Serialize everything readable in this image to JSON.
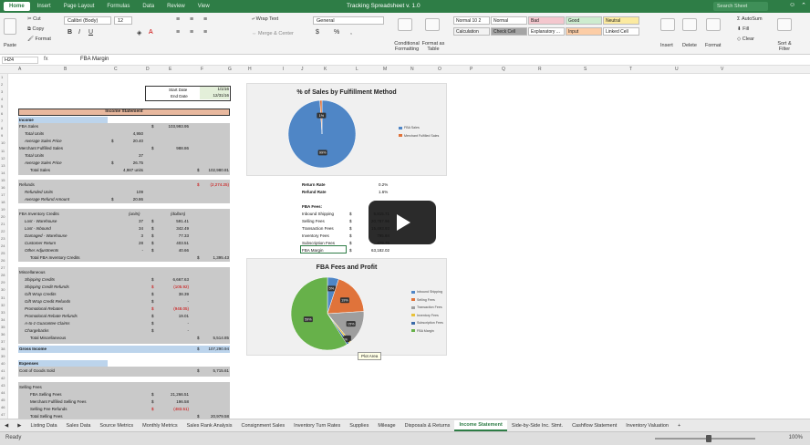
{
  "app": {
    "window_title": "Tracking Spreadsheet v. 1.0",
    "search_placeholder": "Search Sheet",
    "ribbon_tabs": [
      "Home",
      "Insert",
      "Page Layout",
      "Formulas",
      "Data",
      "Review",
      "View"
    ],
    "accent": "#2e7d46"
  },
  "ribbon": {
    "paste": "Paste",
    "cut": "Cut",
    "copy": "Copy",
    "format": "Format",
    "font": "Calibri (Body)",
    "font_size": "12",
    "wrap_text": "Wrap Text",
    "merge_center": "Merge & Center",
    "number_format": "General",
    "conditional": "Conditional Formatting",
    "format_table": "Format as Table",
    "styles": [
      {
        "label": "Normal 10 2",
        "bg": "#ffffff"
      },
      {
        "label": "Normal",
        "bg": "#ffffff"
      },
      {
        "label": "Bad",
        "bg": "#f4c7ce"
      },
      {
        "label": "Good",
        "bg": "#cdeccf"
      },
      {
        "label": "Neutral",
        "bg": "#fbeaa0"
      },
      {
        "label": "Calculation",
        "bg": "#f2f2f2"
      },
      {
        "label": "Check Cell",
        "bg": "#a5a5a5"
      },
      {
        "label": "Explanatory ...",
        "bg": "#ffffff"
      },
      {
        "label": "Input",
        "bg": "#fccda6"
      },
      {
        "label": "Linked Cell",
        "bg": "#ffffff"
      }
    ],
    "insert": "Insert",
    "delete": "Delete",
    "format_cells": "Format",
    "autosum": "AutoSum",
    "fill": "Fill",
    "clear": "Clear",
    "sort_filter": "Sort & Filter"
  },
  "formula_bar": {
    "name_box": "H24",
    "fx": "fx",
    "value": "FBA Margin"
  },
  "columns": [
    "A",
    "B",
    "C",
    "D",
    "E",
    "F",
    "G",
    "H",
    "I",
    "J",
    "K",
    "L",
    "M",
    "N",
    "O",
    "P",
    "Q",
    "R",
    "S",
    "T",
    "U",
    "V"
  ],
  "dates": {
    "start_label": "Start Date",
    "start_value": "1/1/16",
    "end_label": "End Date",
    "end_value": "12/31/16"
  },
  "income_header": "Income Statement",
  "rows": [
    {
      "label": "Income",
      "bold": true
    },
    {
      "label": "FBA Sales",
      "dollar": "$",
      "val": "103,993.95"
    },
    {
      "label": "Total Units",
      "italic": true,
      "sub": "4,950"
    },
    {
      "label": "Average Sales Price",
      "italic": true,
      "subdollar": "$",
      "sub": "20.40"
    },
    {
      "label": "Merchant Fulfilled Sales",
      "dollar": "$",
      "val": "988.86"
    },
    {
      "label": "Total Units",
      "italic": true,
      "sub": "37"
    },
    {
      "label": "Average Sales Price",
      "italic": true,
      "subdollar": "$",
      "sub": "26.75"
    },
    {
      "label": "Total Sales",
      "indent": true,
      "sub": "4,987 units",
      "totaldollar": "$",
      "total": "102,980.81"
    },
    {
      "label": "Refunds",
      "totaldollar": "$",
      "total": "(2,274.25)",
      "red": true
    },
    {
      "label": "Refunded Units",
      "italic": true,
      "sub": "109"
    },
    {
      "label": "Average Refund Amount",
      "italic": true,
      "subdollar": "$",
      "sub": "20.86"
    },
    {
      "label": "FBA Inventory Credits",
      "col1": "(units)",
      "col2": "(dollars)"
    },
    {
      "label": "Lost - Warehouse",
      "italic": true,
      "sub": "37",
      "dollar": "$",
      "val": "591.41"
    },
    {
      "label": "Lost - Inbound",
      "italic": true,
      "sub": "34",
      "dollar": "$",
      "val": "342.49"
    },
    {
      "label": "Damaged - Warehouse",
      "italic": true,
      "sub": "3",
      "dollar": "$",
      "val": "77.33"
    },
    {
      "label": "Customer Return",
      "italic": true,
      "sub": "28",
      "dollar": "$",
      "val": "403.51"
    },
    {
      "label": "Other Adjustments",
      "italic": true,
      "sub": "-",
      "dollar": "$",
      "val": "40.66"
    },
    {
      "label": "Total FBA Inventory Credits",
      "indent": true,
      "totaldollar": "$",
      "total": "1,395.43"
    },
    {
      "label": "Miscellaneous"
    },
    {
      "label": "Shipping Credits",
      "italic": true,
      "dollar": "$",
      "val": "6,667.63"
    },
    {
      "label": "Shipping Credit Refunds",
      "italic": true,
      "dollar": "$",
      "val": "(105.92)",
      "red": true
    },
    {
      "label": "Gift Wrap Credits",
      "italic": true,
      "dollar": "$",
      "val": "38.39"
    },
    {
      "label": "Gift Wrap Credit Refunds",
      "italic": true,
      "dollar": "$",
      "val": "-"
    },
    {
      "label": "Promotional Rebates",
      "italic": true,
      "dollar": "$",
      "val": "(948.05)",
      "red": true
    },
    {
      "label": "Promotional Rebate Refunds",
      "italic": true,
      "dollar": "$",
      "val": "19.01"
    },
    {
      "label": "A-to-z Guarantee Claims",
      "italic": true,
      "dollar": "$",
      "val": "-"
    },
    {
      "label": "Chargebacks",
      "italic": true,
      "dollar": "$",
      "val": "-"
    },
    {
      "label": "Total Miscellaneous",
      "indent": true,
      "totaldollar": "$",
      "total": "5,514.85"
    },
    {
      "label": "Gross Income",
      "bold": true,
      "totaldollar": "$",
      "total": "107,290.94"
    },
    {
      "label": "Expenses",
      "bold": true
    },
    {
      "label": "Cost of Goods Sold",
      "totaldollar": "$",
      "total": "5,715.61"
    },
    {
      "label": "Selling Fees"
    },
    {
      "label": "FBA Selling Fees",
      "indent": true,
      "dollar": "$",
      "val": "21,266.51"
    },
    {
      "label": "Merchant Fulfilled Selling Fees",
      "indent": true,
      "dollar": "$",
      "val": "196.58"
    },
    {
      "label": "Selling Fee Refunds",
      "indent": true,
      "dollar": "$",
      "val": "(483.51)",
      "red": true
    },
    {
      "label": "Total Selling Fees",
      "indent": true,
      "totaldollar": "$",
      "total": "20,979.58"
    }
  ],
  "rates": {
    "return_label": "Return Rate",
    "return_value": "0.2%",
    "refund_label": "Refund Rate",
    "refund_value": "1.6%"
  },
  "fba_fees": {
    "title": "FBA Fees:",
    "items": [
      {
        "label": "Inbound Shipping",
        "dollar": "$",
        "value": "5,815.71"
      },
      {
        "label": "Selling Fees",
        "dollar": "$",
        "value": "20,787.96"
      },
      {
        "label": "Transaction Fees",
        "dollar": "$",
        "value": "15,493.93"
      },
      {
        "label": "Inventory Fees",
        "dollar": "$",
        "value": "795.84"
      },
      {
        "label": "Subscription Fees",
        "dollar": "$",
        "value": "479.76"
      },
      {
        "label": "FBA Margin",
        "dollar": "$",
        "value": "63,182.02"
      }
    ]
  },
  "chart_data": [
    {
      "type": "pie",
      "title": "% of Sales by Fulfillment Method",
      "categories": [
        "FBA Sales",
        "Merchant Fulfilled Sales"
      ],
      "values": [
        99,
        1
      ],
      "colors": [
        "#4f86c6",
        "#e0733a"
      ],
      "data_labels": [
        "99%",
        "1%"
      ],
      "legend": "right"
    },
    {
      "type": "pie",
      "title": "FBA Fees and Profit",
      "categories": [
        "Inbound Shipping",
        "Selling Fees",
        "Transaction Fees",
        "Inventory Fees",
        "Subscription Fees",
        "FBA Margin"
      ],
      "values": [
        5,
        19,
        15,
        1,
        1,
        59
      ],
      "colors": [
        "#4f86c6",
        "#e0733a",
        "#9e9e9e",
        "#e8c23a",
        "#3a6aa8",
        "#67b14a"
      ],
      "data_labels": [
        "5%",
        "19%",
        "15%",
        "1%",
        "1%",
        "59%"
      ],
      "legend": "right"
    }
  ],
  "tooltip": "Plot Area",
  "sheet_tabs": [
    "Listing Data",
    "Sales Data",
    "Source Metrics",
    "Monthly Metrics",
    "Sales Rank Analysis",
    "Consignment Sales",
    "Inventory Turn Rates",
    "Supplies",
    "Mileage",
    "Disposals & Returns",
    "Income Statement",
    "Side-by-Side Inc. Stmt.",
    "Cashflow Statement",
    "Inventory Valuation"
  ],
  "active_sheet": "Income Statement",
  "status": {
    "ready": "Ready",
    "zoom": "100%"
  }
}
